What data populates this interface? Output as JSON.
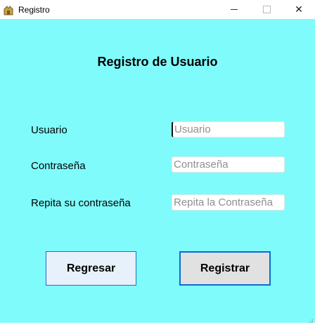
{
  "window": {
    "title": "Registro",
    "icon": "app-icon",
    "controls": {
      "minimize": "minimize-icon",
      "maximize": "maximize-icon",
      "close_glyph": "✕"
    }
  },
  "form": {
    "heading": "Registro de Usuario",
    "fields": [
      {
        "label": "Usuario",
        "placeholder": "Usuario",
        "value": ""
      },
      {
        "label": "Contraseña",
        "placeholder": "Contraseña",
        "value": ""
      },
      {
        "label": "Repita su contraseña",
        "placeholder": "Repita la Contraseña",
        "value": ""
      }
    ]
  },
  "buttons": {
    "back": "Regresar",
    "register": "Registrar"
  },
  "colors": {
    "background": "#80fbfb",
    "accent": "#0a6cd0"
  }
}
